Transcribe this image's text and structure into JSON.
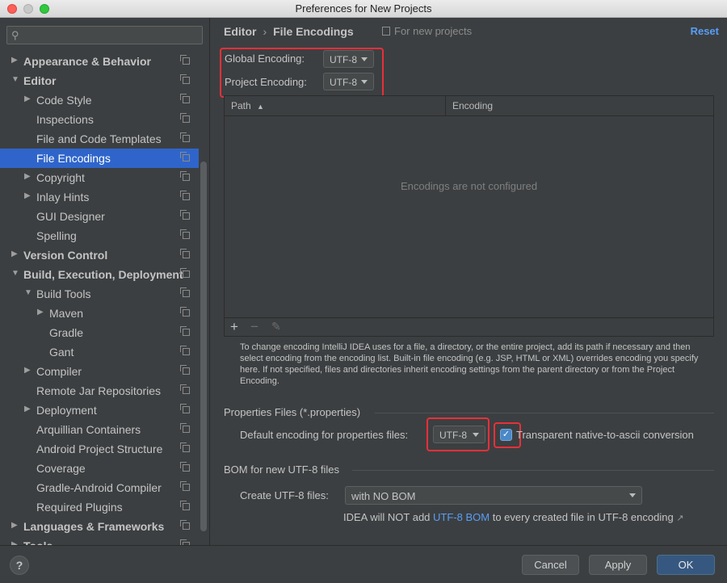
{
  "window": {
    "title": "Preferences for New Projects"
  },
  "sidebar": {
    "search_placeholder": "",
    "items": [
      {
        "label": "Appearance & Behavior",
        "bold": true,
        "arrow": "right",
        "indent": 0
      },
      {
        "label": "Editor",
        "bold": true,
        "arrow": "down",
        "indent": 0
      },
      {
        "label": "Code Style",
        "bold": false,
        "arrow": "right",
        "indent": 1
      },
      {
        "label": "Inspections",
        "bold": false,
        "arrow": "",
        "indent": 1
      },
      {
        "label": "File and Code Templates",
        "bold": false,
        "arrow": "",
        "indent": 1
      },
      {
        "label": "File Encodings",
        "bold": false,
        "arrow": "",
        "indent": 1,
        "selected": true
      },
      {
        "label": "Copyright",
        "bold": false,
        "arrow": "right",
        "indent": 1
      },
      {
        "label": "Inlay Hints",
        "bold": false,
        "arrow": "right",
        "indent": 1
      },
      {
        "label": "GUI Designer",
        "bold": false,
        "arrow": "",
        "indent": 1
      },
      {
        "label": "Spelling",
        "bold": false,
        "arrow": "",
        "indent": 1
      },
      {
        "label": "Version Control",
        "bold": true,
        "arrow": "right",
        "indent": 0
      },
      {
        "label": "Build, Execution, Deployment",
        "bold": true,
        "arrow": "down",
        "indent": 0
      },
      {
        "label": "Build Tools",
        "bold": false,
        "arrow": "down",
        "indent": 1
      },
      {
        "label": "Maven",
        "bold": false,
        "arrow": "right",
        "indent": 2
      },
      {
        "label": "Gradle",
        "bold": false,
        "arrow": "",
        "indent": 2
      },
      {
        "label": "Gant",
        "bold": false,
        "arrow": "",
        "indent": 2
      },
      {
        "label": "Compiler",
        "bold": false,
        "arrow": "right",
        "indent": 1
      },
      {
        "label": "Remote Jar Repositories",
        "bold": false,
        "arrow": "",
        "indent": 1
      },
      {
        "label": "Deployment",
        "bold": false,
        "arrow": "right",
        "indent": 1
      },
      {
        "label": "Arquillian Containers",
        "bold": false,
        "arrow": "",
        "indent": 1
      },
      {
        "label": "Android Project Structure",
        "bold": false,
        "arrow": "",
        "indent": 1
      },
      {
        "label": "Coverage",
        "bold": false,
        "arrow": "",
        "indent": 1
      },
      {
        "label": "Gradle-Android Compiler",
        "bold": false,
        "arrow": "",
        "indent": 1
      },
      {
        "label": "Required Plugins",
        "bold": false,
        "arrow": "",
        "indent": 1
      },
      {
        "label": "Languages & Frameworks",
        "bold": true,
        "arrow": "right",
        "indent": 0
      },
      {
        "label": "Tools",
        "bold": true,
        "arrow": "right",
        "indent": 0
      }
    ]
  },
  "header": {
    "crumb1": "Editor",
    "crumb_sep": "›",
    "crumb2": "File Encodings",
    "for_new": "For new projects",
    "reset": "Reset"
  },
  "encodings": {
    "global_label": "Global Encoding:",
    "global_value": "UTF-8",
    "project_label": "Project Encoding:",
    "project_value": "UTF-8"
  },
  "table": {
    "col_path": "Path",
    "sort_icon": "▲",
    "col_encoding": "Encoding",
    "empty": "Encodings are not configured",
    "add": "+",
    "remove": "−",
    "edit": "✎"
  },
  "help_text": "To change encoding IntelliJ IDEA uses for a file, a directory, or the entire project, add its path if necessary and then select encoding from the encoding list. Built-in file encoding (e.g. JSP, HTML or XML) overrides encoding you specify here. If not specified, files and directories inherit encoding settings from the parent directory or from the Project Encoding.",
  "properties": {
    "section": "Properties Files (*.properties)",
    "default_label": "Default encoding for properties files:",
    "default_value": "UTF-8",
    "checkbox_checked": true,
    "checkbox_mark": "✓",
    "checkbox_label": "Transparent native-to-ascii conversion"
  },
  "bom": {
    "section": "BOM for new UTF-8 files",
    "create_label": "Create UTF-8 files:",
    "create_value": "with NO BOM",
    "note_pre": "IDEA will NOT add ",
    "note_link": "UTF-8 BOM",
    "note_post": " to every created file in UTF-8 encoding",
    "note_arrow": "↗"
  },
  "footer": {
    "help": "?",
    "cancel": "Cancel",
    "apply": "Apply",
    "ok": "OK"
  },
  "colors": {
    "accent": "#2f65ca",
    "link": "#589df6",
    "highlight_box": "#e8303a",
    "primary_button": "#365880"
  }
}
